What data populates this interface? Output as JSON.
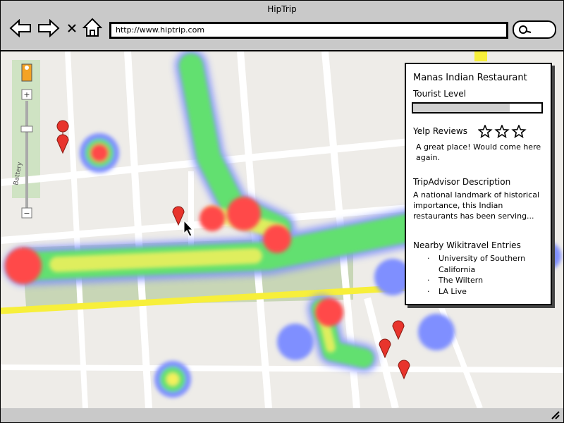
{
  "window": {
    "title": "HipTrip"
  },
  "toolbar": {
    "back_icon": "back-arrow-icon",
    "forward_icon": "forward-arrow-icon",
    "stop_icon": "stop-icon",
    "home_icon": "home-icon",
    "url": "http://www.hiptrip.com",
    "search_icon": "search-icon"
  },
  "map": {
    "street_label": "Battery",
    "zoom_in_label": "+",
    "zoom_out_label": "−",
    "marker_color": "#e8342c",
    "heat_colors": [
      "#6f8bff",
      "#58e86a",
      "#f6f35a",
      "#ff4a4a"
    ]
  },
  "info_panel": {
    "place_name": "Manas Indian Restaurant",
    "tourist_label": "Tourist Level",
    "tourist_level": 0.75,
    "yelp_label": "Yelp Reviews",
    "yelp_stars": 3,
    "yelp_review": "A great place! Would come here again.",
    "tripadvisor_label": "TripAdvisor Description",
    "tripadvisor_text": "A national landmark of historical importance, this Indian restaurants has been serving...",
    "wikitravel_label": "Nearby Wikitravel Entries",
    "wikitravel_entries": [
      "University of Southern California",
      "The Wiltern",
      "LA Live"
    ]
  }
}
